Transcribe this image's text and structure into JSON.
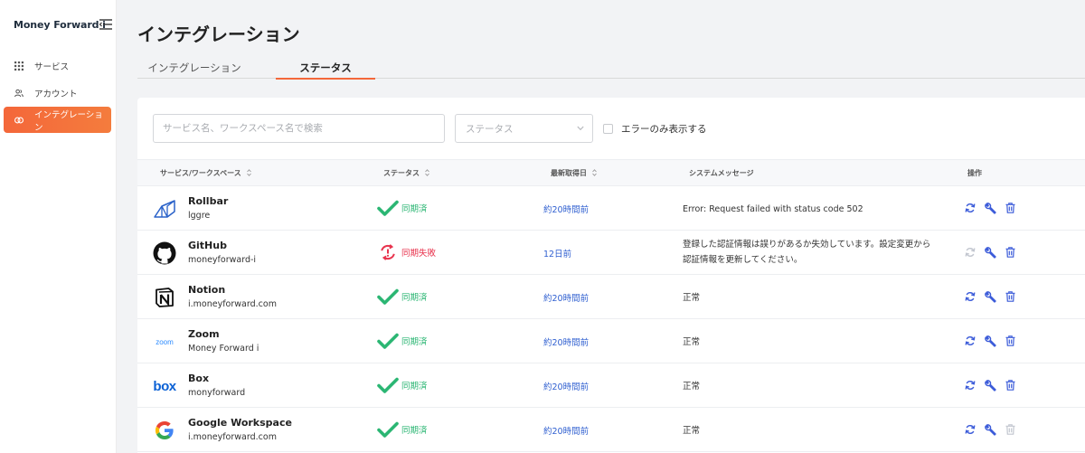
{
  "sidebar": {
    "brand": "Money Forward i",
    "items": [
      {
        "label": "サービス",
        "icon": "grid-icon"
      },
      {
        "label": "アカウント",
        "icon": "users-icon"
      },
      {
        "label": "インテグレーション",
        "icon": "link-icon",
        "active": true
      }
    ]
  },
  "header": {
    "title": "インテグレーション",
    "tabs": [
      {
        "label": "インテグレーション"
      },
      {
        "label": "ステータス",
        "active": true
      }
    ]
  },
  "filters": {
    "search_placeholder": "サービス名、ワークスペース名で検索",
    "status_placeholder": "ステータス",
    "error_only_label": "エラーのみ表示する"
  },
  "table": {
    "columns": [
      "サービス/ワークスペース",
      "ステータス",
      "最新取得日",
      "システムメッセージ",
      "操作"
    ],
    "rows": [
      {
        "service": "Rollbar",
        "workspace": "lggre",
        "status": "同期済",
        "date": "約20時間前",
        "message": "Error: Request failed with status code 502",
        "logo": "rollbar-logo"
      },
      {
        "service": "GitHub",
        "workspace": "moneyforward-i",
        "status": "同期失敗",
        "date": "12日前",
        "message": "登録した認証情報は誤りがあるか失効しています。設定変更から認証情報を更新してください。",
        "logo": "github-logo"
      },
      {
        "service": "Notion",
        "workspace": "i.moneyforward.com",
        "status": "同期済",
        "date": "約20時間前",
        "message": "正常",
        "logo": "notion-logo"
      },
      {
        "service": "Zoom",
        "workspace": "Money Forward i",
        "status": "同期済",
        "date": "約20時間前",
        "message": "正常",
        "logo": "zoom-logo",
        "logo_text": "zoom"
      },
      {
        "service": "Box",
        "workspace": "monyforward",
        "status": "同期済",
        "date": "約20時間前",
        "message": "正常",
        "logo": "box-logo",
        "logo_text": "box"
      },
      {
        "service": "Google Workspace",
        "workspace": "i.moneyforward.com",
        "status": "同期済",
        "date": "約20時間前",
        "message": "正常",
        "logo": "google-logo"
      }
    ]
  },
  "colors": {
    "accent": "#f4673a",
    "success": "#2bb673",
    "error": "#e8344e",
    "link": "#2f5fd0",
    "action": "#3b5bd9"
  }
}
